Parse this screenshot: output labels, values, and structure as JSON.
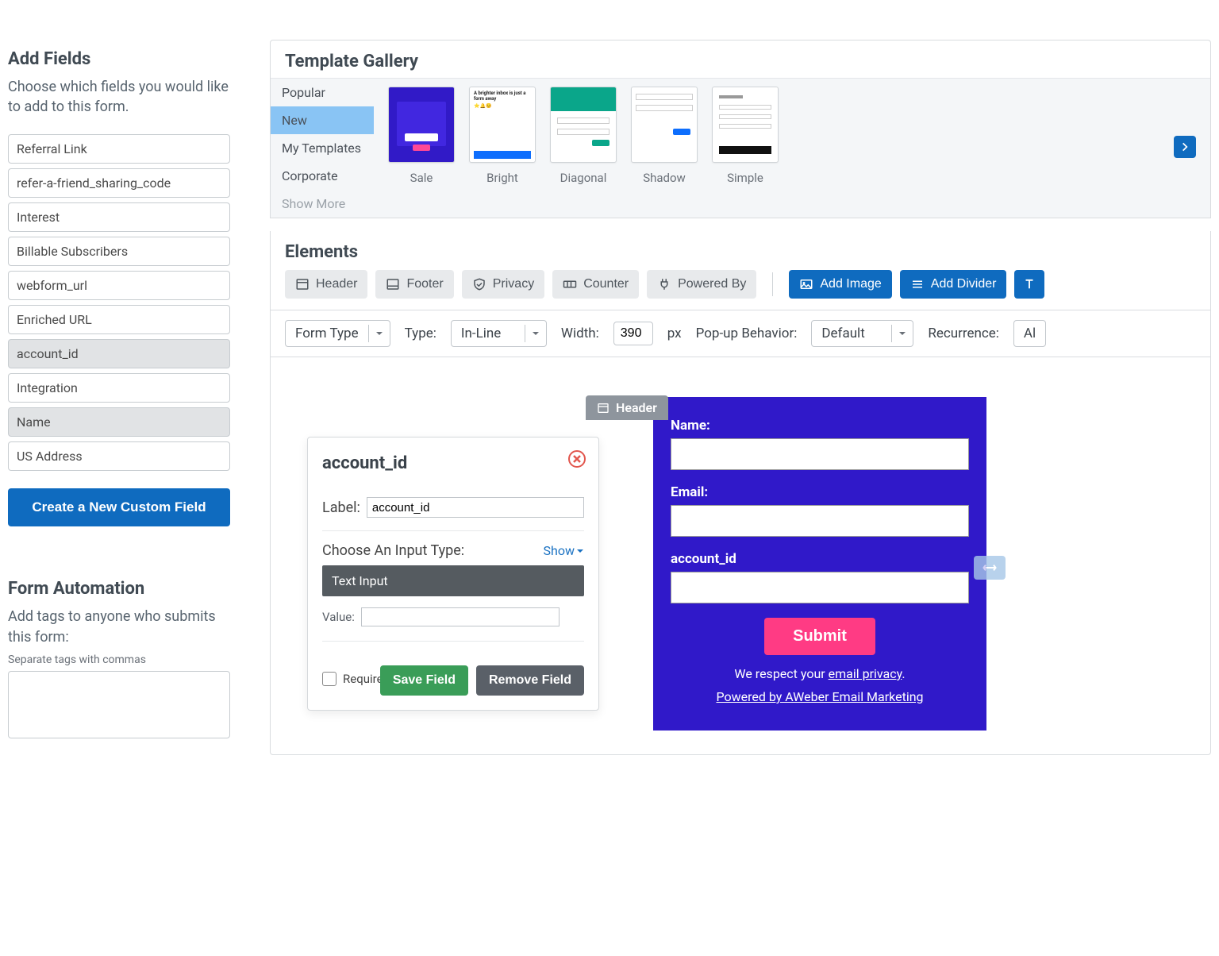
{
  "sidebar": {
    "add_fields_title": "Add Fields",
    "add_fields_desc": "Choose which fields you would like to add to this form.",
    "fields": [
      {
        "label": "Referral Link",
        "selected": false
      },
      {
        "label": "refer-a-friend_sharing_code",
        "selected": false
      },
      {
        "label": "Interest",
        "selected": false
      },
      {
        "label": "Billable Subscribers",
        "selected": false
      },
      {
        "label": "webform_url",
        "selected": false
      },
      {
        "label": "Enriched URL",
        "selected": false
      },
      {
        "label": "account_id",
        "selected": true
      },
      {
        "label": "Integration",
        "selected": false
      },
      {
        "label": "Name",
        "selected": true
      },
      {
        "label": "US Address",
        "selected": false
      }
    ],
    "create_field_btn": "Create a New Custom Field",
    "automation_title": "Form Automation",
    "automation_desc": "Add tags to anyone who submits this form:",
    "automation_hint": "Separate tags with commas"
  },
  "gallery": {
    "title": "Template Gallery",
    "categories": [
      "Popular",
      "New",
      "My Templates",
      "Corporate",
      "Show More"
    ],
    "active_category": "New",
    "templates": [
      "Sale",
      "Bright",
      "Diagonal",
      "Shadow",
      "Simple"
    ]
  },
  "elements": {
    "title": "Elements",
    "buttons": {
      "header": "Header",
      "footer": "Footer",
      "privacy": "Privacy",
      "counter": "Counter",
      "powered_by": "Powered By",
      "add_image": "Add Image",
      "add_divider": "Add Divider"
    },
    "options": {
      "form_type_label": "Form Type",
      "type_label": "Type:",
      "type_value": "In-Line",
      "width_label": "Width:",
      "width_value": "390",
      "width_unit": "px",
      "popup_label": "Pop-up Behavior:",
      "popup_value": "Default",
      "recurrence_label": "Recurrence:",
      "recurrence_value": "Al"
    }
  },
  "preview": {
    "header_tab": "Header",
    "name_label": "Name:",
    "email_label": "Email:",
    "account_label": "account_id",
    "submit": "Submit",
    "privacy_pre": "We respect your ",
    "privacy_link": "email privacy",
    "powered_by": "Powered by AWeber Email Marketing"
  },
  "editor": {
    "title": "account_id",
    "label_label": "Label:",
    "label_value": "account_id",
    "choose_input": "Choose An Input Type:",
    "show": "Show",
    "input_type": "Text Input",
    "value_label": "Value:",
    "value": "",
    "required_label": "Required",
    "save_btn": "Save Field",
    "remove_btn": "Remove Field"
  }
}
